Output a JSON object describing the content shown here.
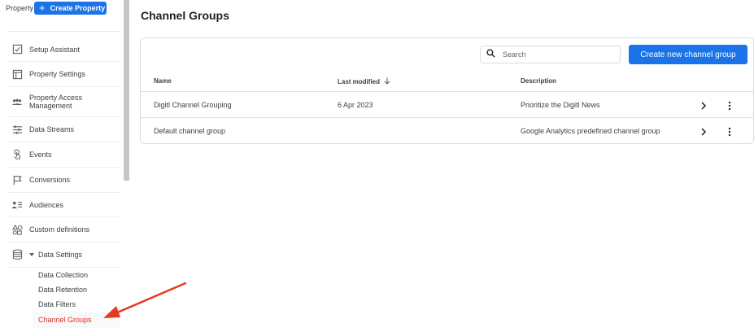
{
  "sidebar": {
    "property_label": "Property",
    "create_property_label": "Create Property",
    "items": [
      {
        "label": "Setup Assistant",
        "icon": "checklist-icon"
      },
      {
        "label": "Property Settings",
        "icon": "property-settings-icon"
      },
      {
        "label": "Property Access\nManagement",
        "icon": "people-icon"
      },
      {
        "label": "Data Streams",
        "icon": "streams-icon"
      },
      {
        "label": "Events",
        "icon": "touch-icon"
      },
      {
        "label": "Conversions",
        "icon": "flag-icon"
      },
      {
        "label": "Audiences",
        "icon": "audience-icon"
      },
      {
        "label": "Custom definitions",
        "icon": "shapes-icon"
      },
      {
        "label": "Data Settings",
        "icon": "database-icon"
      }
    ],
    "sub_items": [
      {
        "label": "Data Collection"
      },
      {
        "label": "Data Retention"
      },
      {
        "label": "Data Filters"
      },
      {
        "label": "Channel Groups",
        "active": true
      }
    ]
  },
  "main": {
    "title": "Channel Groups",
    "search": {
      "placeholder": "Search",
      "value": ""
    },
    "create_button": "Create new channel group",
    "columns": {
      "name": "Name",
      "last_modified": "Last modified",
      "description": "Description"
    },
    "rows": [
      {
        "name": "Digitl Channel Grouping",
        "last_modified": "6 Apr 2023",
        "description": "Prioritize the Digitl News"
      },
      {
        "name": "Default channel group",
        "last_modified": "",
        "description": "Google Analytics predefined channel group"
      }
    ]
  },
  "colors": {
    "primary": "#1a73e8",
    "active_link": "#d93025",
    "annotation_arrow": "#e8391f"
  }
}
